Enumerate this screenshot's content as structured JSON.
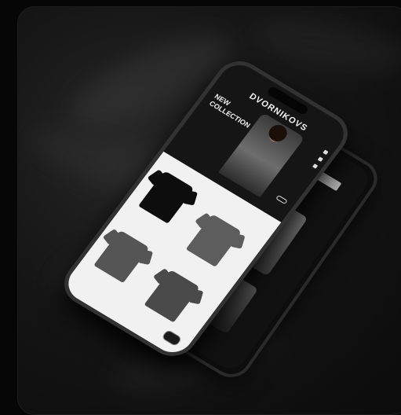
{
  "scene": "",
  "app": {
    "brand": "DVORNIKOVS",
    "promo_title": "NEW COLLECTION",
    "promo_sub": "",
    "promo_link": "",
    "promo_button": "",
    "filters": "",
    "products": [
      {
        "label": "",
        "color": "#0d0d0d"
      },
      {
        "label": "",
        "color": "#5d5d5d"
      },
      {
        "label": "",
        "color": "#555555"
      },
      {
        "label": "",
        "color": "#4a4a4a"
      }
    ],
    "footer_text": ""
  },
  "back_phone": {
    "label": ""
  },
  "colors": {
    "background": "#060606",
    "phone_frame": "#323232",
    "grid_bg": "#f1f1f1"
  }
}
